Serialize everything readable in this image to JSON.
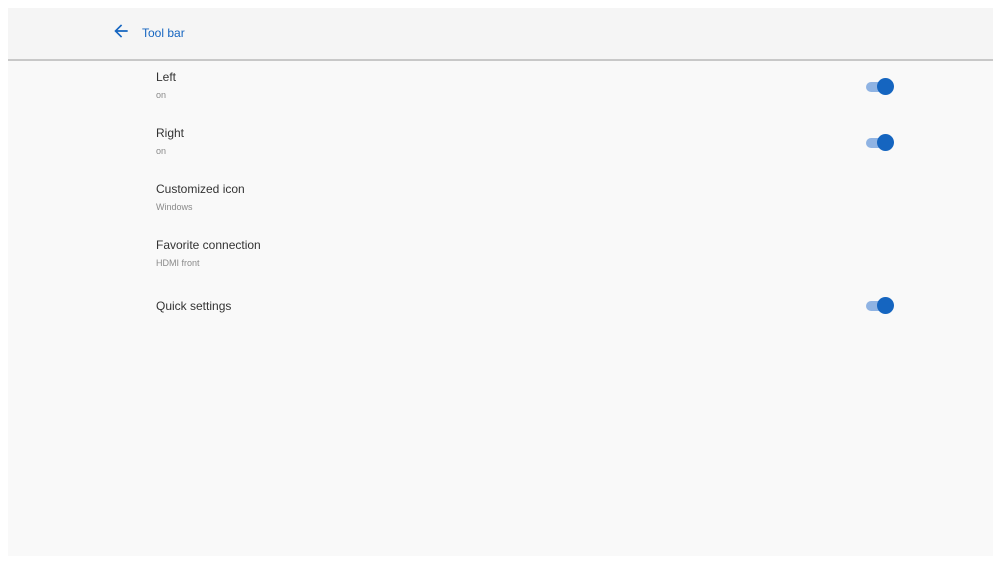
{
  "appbar": {
    "title": "Tool bar",
    "back_icon": "arrow-left-icon",
    "accent_color": "#1565c0"
  },
  "settings": [
    {
      "title": "Left",
      "subtitle": "on",
      "toggle": true,
      "toggle_on": true
    },
    {
      "title": "Right",
      "subtitle": "on",
      "toggle": true,
      "toggle_on": true
    },
    {
      "title": "Customized icon",
      "subtitle": "Windows",
      "toggle": false
    },
    {
      "title": "Favorite connection",
      "subtitle": "HDMI front",
      "toggle": false
    },
    {
      "title": "Quick settings",
      "subtitle": "",
      "toggle": true,
      "toggle_on": true
    }
  ]
}
